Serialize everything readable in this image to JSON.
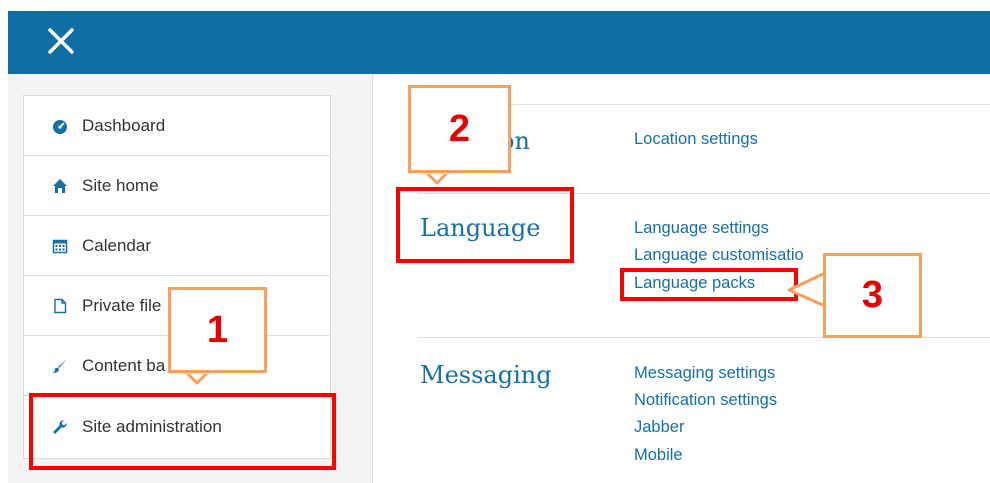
{
  "header": {
    "close_icon": "close-icon",
    "bar_color": "#0f6ea3"
  },
  "sidebar": {
    "items": [
      {
        "label": "Dashboard",
        "icon": "dashboard-icon"
      },
      {
        "label": "Site home",
        "icon": "home-icon"
      },
      {
        "label": "Calendar",
        "icon": "calendar-icon"
      },
      {
        "label": "Private file",
        "icon": "file-icon"
      },
      {
        "label": "Content ba",
        "icon": "brush-icon"
      },
      {
        "label": "Site administration",
        "icon": "wrench-icon"
      }
    ]
  },
  "main": {
    "sections": [
      {
        "heading": "on",
        "links": [
          "Location settings"
        ]
      },
      {
        "heading": "Language",
        "links": [
          "Language settings",
          "Language customisatio",
          "Language packs"
        ]
      },
      {
        "heading": "Messaging",
        "links": [
          "Messaging settings",
          "Notification settings",
          "Jabber",
          "Mobile"
        ]
      }
    ]
  },
  "annotations": {
    "callouts": [
      "1",
      "2",
      "3"
    ],
    "highlight_color": "#ff0000",
    "callout_border_color": "#f4a15d"
  }
}
